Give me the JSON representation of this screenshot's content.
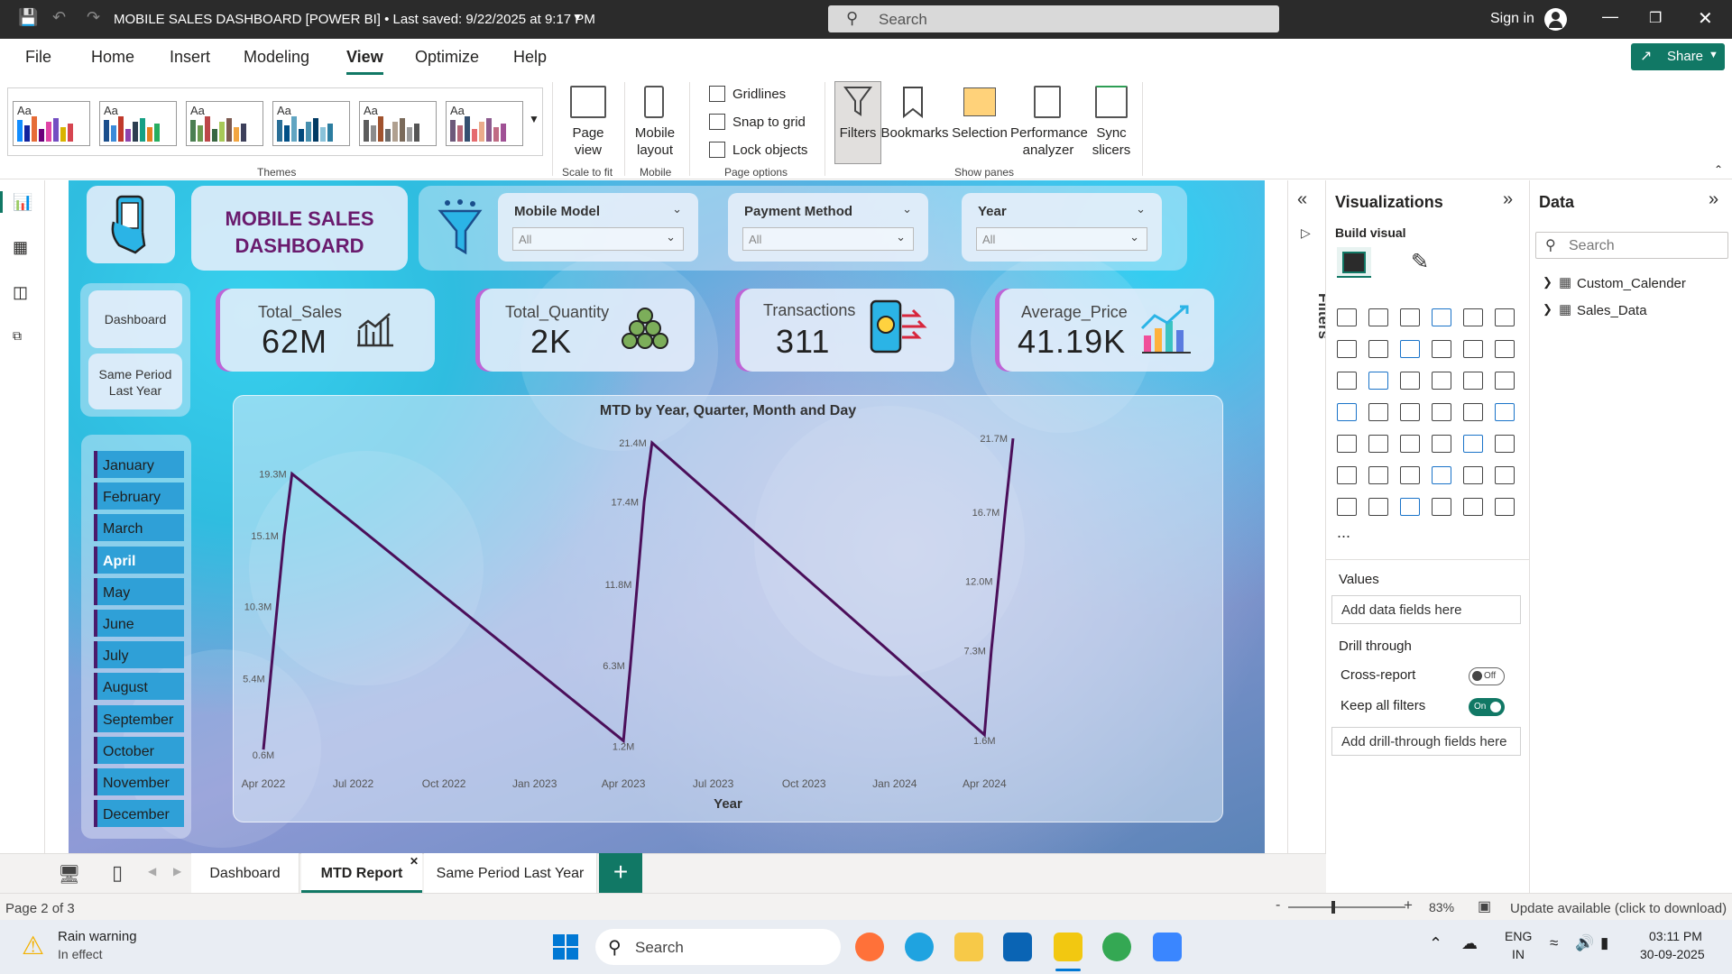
{
  "titlebar": {
    "title": "MOBILE SALES DASHBOARD [POWER BI] • Last saved: 9/22/2025 at 9:17 PM",
    "search_placeholder": "Search",
    "signin": "Sign in"
  },
  "menu": [
    "File",
    "Home",
    "Insert",
    "Modeling",
    "View",
    "Optimize",
    "Help"
  ],
  "share_label": "Share",
  "ribbon": {
    "themes_label": "Themes",
    "theme_aa": "Aa",
    "page_view": "Page view",
    "scale_to_fit": "Scale to fit",
    "mobile_layout": "Mobile layout",
    "mobile_group": "Mobile",
    "gridlines": "Gridlines",
    "snap_to_grid": "Snap to grid",
    "lock_objects": "Lock objects",
    "page_options": "Page options",
    "filters": "Filters",
    "bookmarks": "Bookmarks",
    "selection": "Selection",
    "performance": "Performance analyzer",
    "sync_slicers": "Sync slicers",
    "show_panes": "Show panes"
  },
  "dashboard": {
    "title_line1": "MOBILE SALES",
    "title_line2": "DASHBOARD",
    "slicers": [
      {
        "label": "Mobile Model",
        "value": "All"
      },
      {
        "label": "Payment Method",
        "value": "All"
      },
      {
        "label": "Year",
        "value": "All"
      }
    ],
    "nav": [
      "Dashboard",
      "Same Period Last Year"
    ],
    "kpis": [
      {
        "label": "Total_Sales",
        "value": "62M"
      },
      {
        "label": "Total_Quantity",
        "value": "2K"
      },
      {
        "label": "Transactions",
        "value": "311"
      },
      {
        "label": "Average_Price",
        "value": "41.19K"
      }
    ],
    "months": [
      "January",
      "February",
      "March",
      "April",
      "May",
      "June",
      "July",
      "August",
      "September",
      "October",
      "November",
      "December"
    ],
    "selected_month": "April"
  },
  "chart_data": {
    "type": "line",
    "title": "MTD by Year, Quarter, Month and Day",
    "xlabel": "Year",
    "ylabel": "",
    "x_ticks": [
      "Apr 2022",
      "Jul 2022",
      "Oct 2022",
      "Jan 2023",
      "Apr 2023",
      "Jul 2023",
      "Oct 2023",
      "Jan 2024",
      "Apr 2024"
    ],
    "series": [
      {
        "color": "#4b0f5a",
        "points": [
          {
            "x": "2022-04-01",
            "y": 0.6,
            "label": "0.6M"
          },
          {
            "x": "2022-04-08",
            "y": 5.4,
            "label": "5.4M"
          },
          {
            "x": "2022-04-15",
            "y": 10.3,
            "label": "10.3M"
          },
          {
            "x": "2022-04-22",
            "y": 15.1,
            "label": "15.1M"
          },
          {
            "x": "2022-04-30",
            "y": 19.3,
            "label": "19.3M"
          },
          {
            "x": "2023-04-01",
            "y": 1.2,
            "label": "1.2M"
          },
          {
            "x": "2023-04-08",
            "y": 6.3,
            "label": "6.3M"
          },
          {
            "x": "2023-04-15",
            "y": 11.8,
            "label": "11.8M"
          },
          {
            "x": "2023-04-22",
            "y": 17.4,
            "label": "17.4M"
          },
          {
            "x": "2023-04-30",
            "y": 21.4,
            "label": "21.4M"
          },
          {
            "x": "2024-04-01",
            "y": 1.6,
            "label": "1.6M"
          },
          {
            "x": "2024-04-08",
            "y": 7.3,
            "label": "7.3M"
          },
          {
            "x": "2024-04-15",
            "y": 12.0,
            "label": "12.0M"
          },
          {
            "x": "2024-04-22",
            "y": 16.7,
            "label": "16.7M"
          },
          {
            "x": "2024-04-30",
            "y": 21.7,
            "label": "21.7M"
          }
        ]
      }
    ]
  },
  "visualizations": {
    "title": "Visualizations",
    "build_visual": "Build visual",
    "values": "Values",
    "add_data_fields": "Add data fields here",
    "drill_through": "Drill through",
    "cross_report": "Cross-report",
    "cross_report_state": "Off",
    "keep_all_filters": "Keep all filters",
    "keep_all_filters_state": "On",
    "add_drill_fields": "Add drill-through fields here",
    "more": "..."
  },
  "filters_label": "Filters",
  "data_pane": {
    "title": "Data",
    "search_placeholder": "Search",
    "tables": [
      "Custom_Calender",
      "Sales_Data"
    ]
  },
  "tabs": [
    "Dashboard",
    "MTD Report",
    "Same Period Last Year"
  ],
  "active_tab": "MTD Report",
  "status": {
    "page": "Page 2 of 3",
    "zoom": "83%",
    "update": "Update available (click to download)"
  },
  "taskbar": {
    "weather_title": "Rain warning",
    "weather_sub": "In effect",
    "search": "Search",
    "lang1": "ENG",
    "lang2": "IN",
    "time": "03:11 PM",
    "date": "30-09-2025"
  }
}
